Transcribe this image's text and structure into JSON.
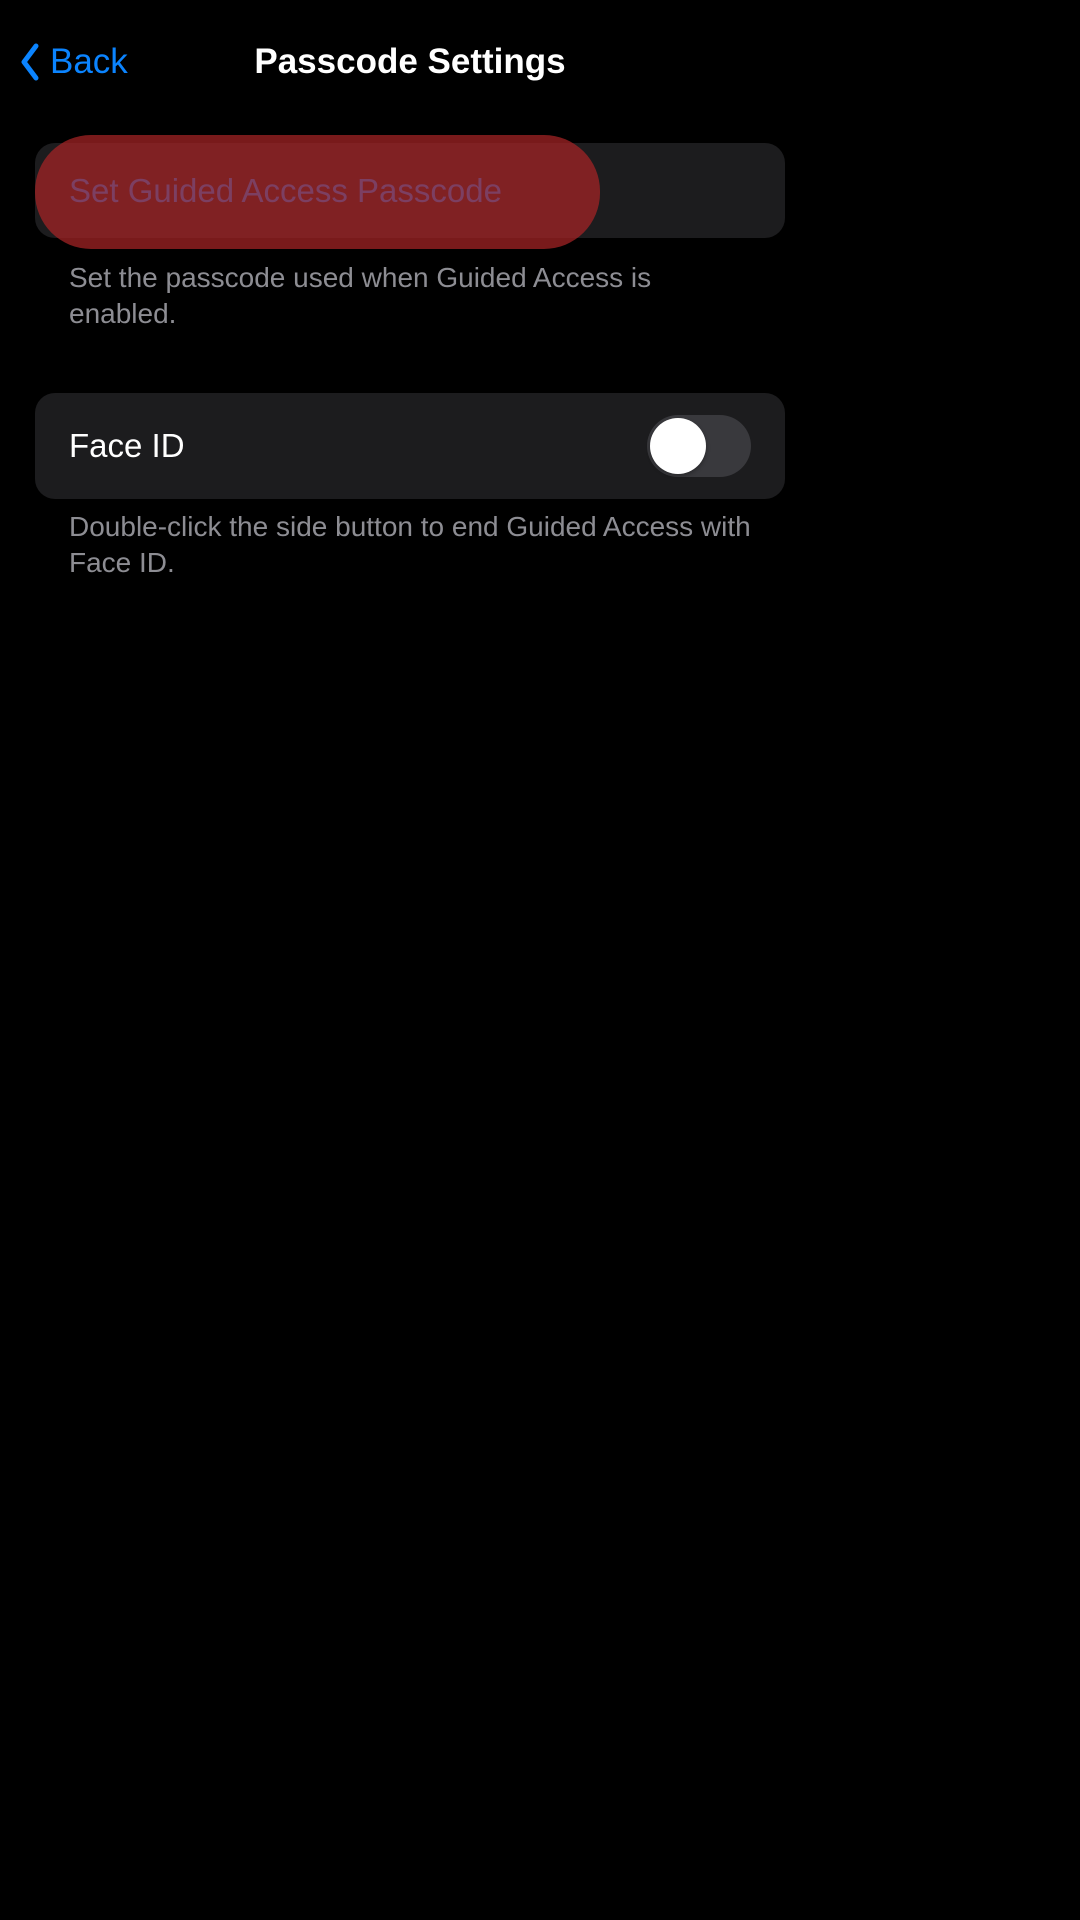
{
  "nav": {
    "back_label": "Back",
    "title": "Passcode Settings"
  },
  "sections": {
    "set_passcode": {
      "button_label": "Set Guided Access Passcode",
      "footer": "Set the passcode used when Guided Access is enabled."
    },
    "face_id": {
      "label": "Face ID",
      "toggle_state": "off",
      "footer": "Double-click the side button to end Guided Access with Face ID."
    }
  },
  "colors": {
    "accent": "#0b84ff",
    "row_background": "#1c1c1e",
    "footer_text": "#8d8d93",
    "highlight": "rgba(168,36,38,0.72)"
  }
}
